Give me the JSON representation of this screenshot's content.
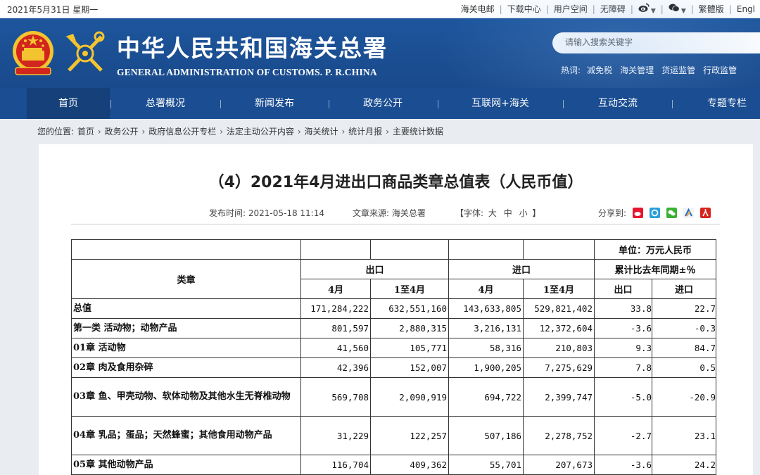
{
  "topbar": {
    "date": "2021年5月31日 星期一",
    "links": [
      "海关电邮",
      "下载中心",
      "用户空间",
      "无障碍"
    ],
    "traditional": "繁體版",
    "english": "Engl"
  },
  "header": {
    "title": "中华人民共和国海关总署",
    "subtitle": "GENERAL ADMINISTRATION OF CUSTOMS. P. R.CHINA",
    "search_placeholder": "请输入搜索关键字",
    "hotwords_label": "热词:",
    "hotwords": [
      "减免税",
      "海关管理",
      "货运监管",
      "行政监管"
    ]
  },
  "nav": {
    "items": [
      "首页",
      "总署概况",
      "新闻发布",
      "政务公开",
      "互联网+海关",
      "互动交流",
      "专题专栏"
    ]
  },
  "breadcrumb": {
    "label": "您的位置:",
    "items": [
      "首页",
      "政务公开",
      "政府信息公开专栏",
      "法定主动公开内容",
      "海关统计",
      "统计月报",
      "主要统计数据"
    ]
  },
  "article": {
    "title": "（4）2021年4月进出口商品类章总值表（人民币值）",
    "publish_time": "发布时间: 2021-05-18 11:14",
    "source": "文章来源: 海关总署",
    "font_label_open": "【字体:",
    "font_large": "大",
    "font_medium": "中",
    "font_small": "小",
    "font_label_close": "】",
    "share_label": "分享到:"
  },
  "table": {
    "unit": "单位：万元人民币",
    "col_category": "类章",
    "col_export": "出口",
    "col_import": "进口",
    "col_yoy": "累计比去年同期±％",
    "sub_month": "4月",
    "sub_cum": "1至4月",
    "sub_exp": "出口",
    "sub_imp": "进口",
    "rows": [
      {
        "name": "总值",
        "exp_m": "171,284,222",
        "exp_c": "632,551,160",
        "imp_m": "143,633,805",
        "imp_c": "529,821,402",
        "yoy_e": "33.8",
        "yoy_i": "22.7"
      },
      {
        "name": "第一类 活动物；动物产品",
        "exp_m": "801,597",
        "exp_c": "2,880,315",
        "imp_m": "3,216,131",
        "imp_c": "12,372,604",
        "yoy_e": "-3.6",
        "yoy_i": "-0.3"
      },
      {
        "name": "01章 活动物",
        "exp_m": "41,560",
        "exp_c": "105,771",
        "imp_m": "58,316",
        "imp_c": "210,803",
        "yoy_e": "9.3",
        "yoy_i": "84.7"
      },
      {
        "name": "02章 肉及食用杂碎",
        "exp_m": "42,396",
        "exp_c": "152,007",
        "imp_m": "1,900,205",
        "imp_c": "7,275,629",
        "yoy_e": "7.8",
        "yoy_i": "0.5"
      },
      {
        "name": "03章 鱼、甲壳动物、软体动物及其他水生无脊椎动物",
        "exp_m": "569,708",
        "exp_c": "2,090,919",
        "imp_m": "694,722",
        "imp_c": "2,399,747",
        "yoy_e": "-5.0",
        "yoy_i": "-20.9"
      },
      {
        "name": "04章 乳品；蛋品；天然蜂蜜；其他食用动物产品",
        "exp_m": "31,229",
        "exp_c": "122,257",
        "imp_m": "507,186",
        "imp_c": "2,278,752",
        "yoy_e": "-2.7",
        "yoy_i": "23.1"
      },
      {
        "name": "05章 其他动物产品",
        "exp_m": "116,704",
        "exp_c": "409,362",
        "imp_m": "55,701",
        "imp_c": "207,673",
        "yoy_e": "-3.6",
        "yoy_i": "24.2"
      }
    ]
  },
  "colors": {
    "header_blue": "#1f5aa3",
    "nav_blue": "#1a4d91",
    "nav_active": "#154079",
    "page_bg": "#e9edf2"
  },
  "icons": [
    "national-emblem",
    "customs-emblem",
    "weibo-icon",
    "wechat-icon",
    "share-icons"
  ]
}
